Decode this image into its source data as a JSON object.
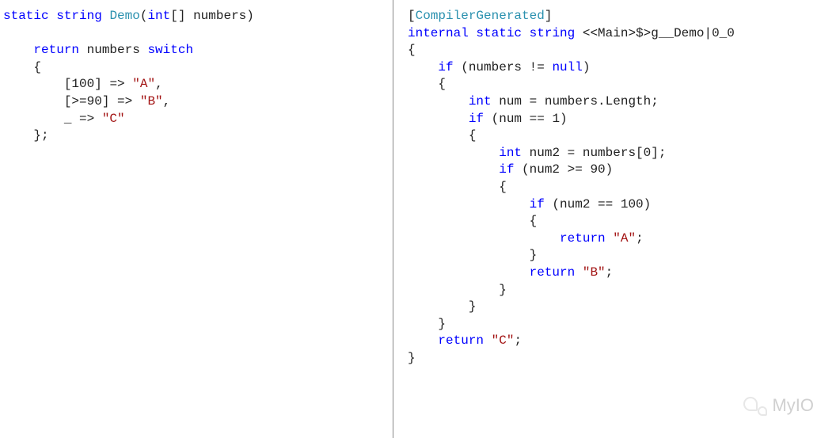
{
  "left": {
    "l01a": "static",
    "l01b": "string",
    "l01c": "Demo",
    "l01d": "int",
    "l01e": "[] numbers)",
    "l02": "",
    "l03a": "    ",
    "l03b": "return",
    "l03c": " numbers ",
    "l03d": "switch",
    "l04": "    {",
    "l05a": "        [",
    "l05b": "100",
    "l05c": "] => ",
    "l05d": "\"A\"",
    "l05e": ",",
    "l06a": "        [>=",
    "l06b": "90",
    "l06c": "] => ",
    "l06d": "\"B\"",
    "l06e": ",",
    "l07a": "        _ => ",
    "l07b": "\"C\"",
    "l08": "    };"
  },
  "right": {
    "r01a": "[",
    "r01b": "CompilerGenerated",
    "r01c": "]",
    "r02a": "internal",
    "r02b": "static",
    "r02c": "string",
    "r02d": " <<Main>$>g__Demo|0_0",
    "r03": "{",
    "r04a": "    ",
    "r04b": "if",
    "r04c": " (numbers != ",
    "r04d": "null",
    "r04e": ")",
    "r05": "    {",
    "r06a": "        ",
    "r06b": "int",
    "r06c": " num = numbers.Length;",
    "r07a": "        ",
    "r07b": "if",
    "r07c": " (num == ",
    "r07d": "1",
    "r07e": ")",
    "r08": "        {",
    "r09a": "            ",
    "r09b": "int",
    "r09c": " num2 = numbers[",
    "r09d": "0",
    "r09e": "];",
    "r10a": "            ",
    "r10b": "if",
    "r10c": " (num2 >= ",
    "r10d": "90",
    "r10e": ")",
    "r11": "            {",
    "r12a": "                ",
    "r12b": "if",
    "r12c": " (num2 == ",
    "r12d": "100",
    "r12e": ")",
    "r13": "                {",
    "r14a": "                    ",
    "r14b": "return",
    "r14c": " ",
    "r14d": "\"A\"",
    "r14e": ";",
    "r15": "                }",
    "r16a": "                ",
    "r16b": "return",
    "r16c": " ",
    "r16d": "\"B\"",
    "r16e": ";",
    "r17": "            }",
    "r18": "        }",
    "r19": "    }",
    "r20a": "    ",
    "r20b": "return",
    "r20c": " ",
    "r20d": "\"C\"",
    "r20e": ";",
    "r21": "}"
  },
  "watermark": "MyIO"
}
